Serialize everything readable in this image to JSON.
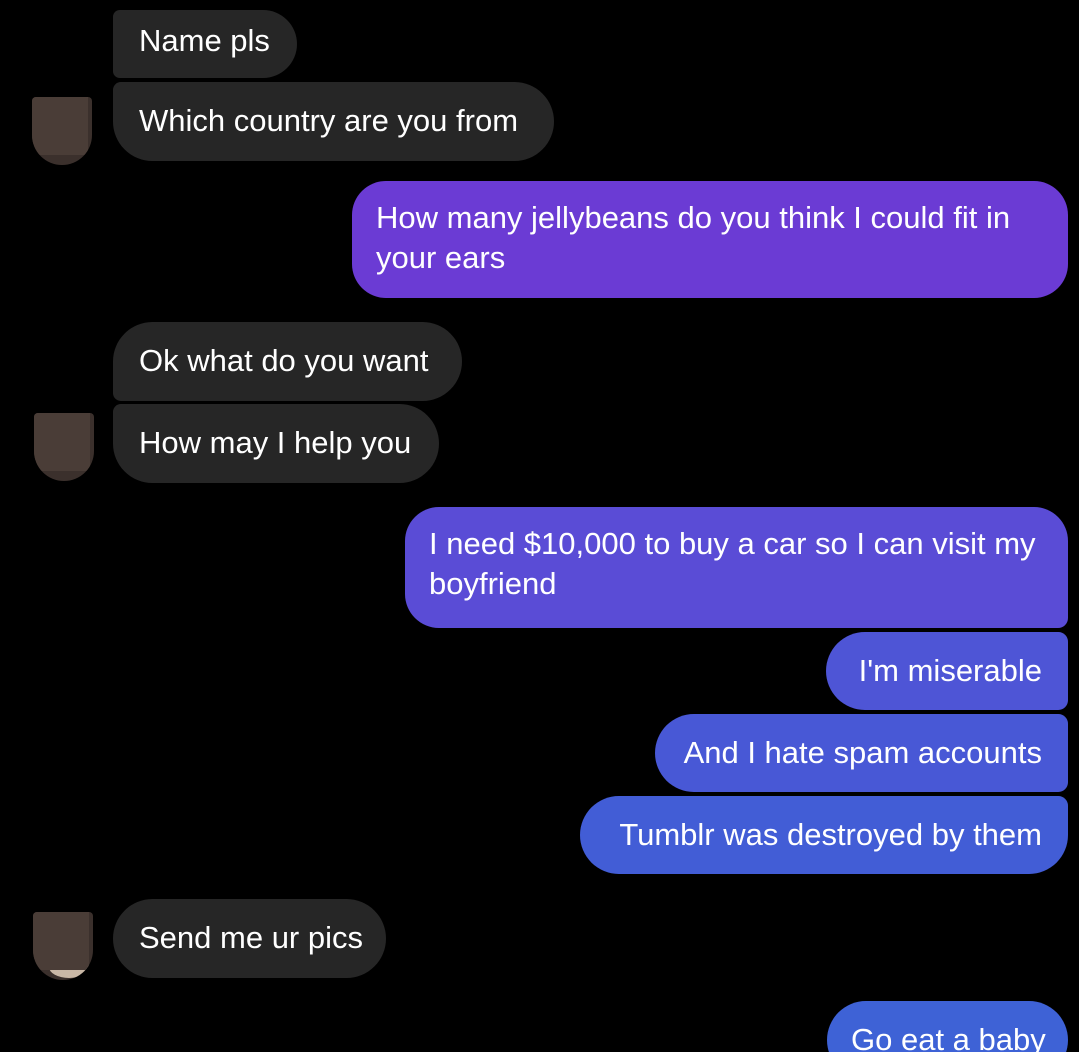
{
  "conversation": {
    "messages": [
      {
        "sender": "contact",
        "text": "Name pls"
      },
      {
        "sender": "contact",
        "text": "Which country are you from"
      },
      {
        "sender": "me",
        "text": "How many jellybeans do you think I could fit in your ears"
      },
      {
        "sender": "contact",
        "text": "Ok what do you want"
      },
      {
        "sender": "contact",
        "text": "How may I help you"
      },
      {
        "sender": "me",
        "text": "I need $10,000 to buy a car so I can visit my boyfriend"
      },
      {
        "sender": "me",
        "text": "I'm miserable"
      },
      {
        "sender": "me",
        "text": "And I hate spam accounts"
      },
      {
        "sender": "me",
        "text": "Tumblr was destroyed by them"
      },
      {
        "sender": "contact",
        "text": "Send me ur pics"
      },
      {
        "sender": "me",
        "text": "Go eat a baby"
      }
    ],
    "avatar_icon": "contact-avatar-redacted"
  },
  "colors": {
    "background": "#000000",
    "incoming_bubble": "#262626",
    "outgoing_gradient_top": "#7a38d6",
    "outgoing_gradient_bottom": "#3e66d6",
    "text": "#ffffff"
  }
}
